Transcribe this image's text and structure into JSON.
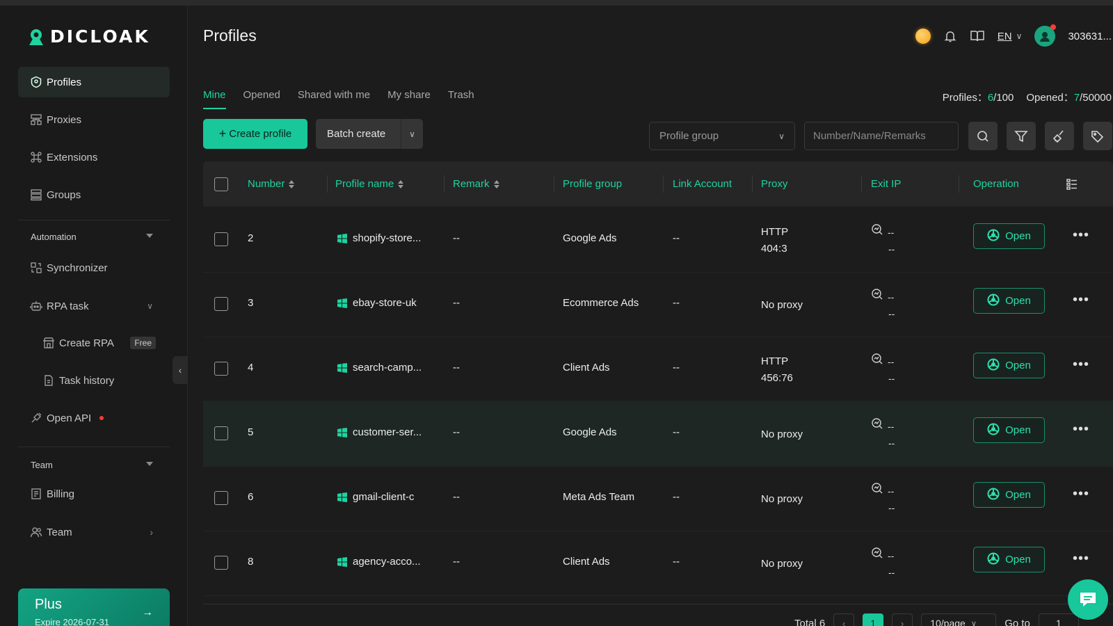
{
  "brand": {
    "name": "DICLOAK"
  },
  "sidebar": {
    "items": [
      {
        "label": "Profiles",
        "icon": "profiles-icon"
      },
      {
        "label": "Proxies",
        "icon": "proxies-icon"
      },
      {
        "label": "Extensions",
        "icon": "extensions-icon"
      },
      {
        "label": "Groups",
        "icon": "groups-icon"
      }
    ],
    "automation": {
      "label": "Automation",
      "items": [
        {
          "label": "Synchronizer"
        },
        {
          "label": "RPA task"
        },
        {
          "label": "Create RPA",
          "badge": "Free"
        },
        {
          "label": "Task history"
        },
        {
          "label": "Open API"
        }
      ]
    },
    "team": {
      "label": "Team",
      "items": [
        {
          "label": "Billing"
        },
        {
          "label": "Team"
        }
      ]
    },
    "plan": {
      "title": "Plus",
      "expire": "Expire 2026-07-31"
    }
  },
  "header": {
    "title": "Profiles",
    "lang": "EN",
    "user": "303631..."
  },
  "tabs": [
    "Mine",
    "Opened",
    "Shared with me",
    "My share",
    "Trash"
  ],
  "counts": {
    "profiles_label": "Profiles：",
    "profiles_used": "6",
    "profiles_total": "/100",
    "opened_label": "Opened：",
    "opened_used": "7",
    "opened_total": "/50000"
  },
  "toolbar": {
    "create_label": "Create profile",
    "batch_label": "Batch create",
    "group_placeholder": "Profile group",
    "search_placeholder": "Number/Name/Remarks"
  },
  "table": {
    "columns": [
      "Number",
      "Profile name",
      "Remark",
      "Profile group",
      "Link Account",
      "Proxy",
      "Exit IP",
      "Operation"
    ],
    "open_label": "Open",
    "rows": [
      {
        "number": "2",
        "name": "shopify-store...",
        "remark": "--",
        "group": "Google Ads",
        "link": "--",
        "proxy1": "HTTP",
        "proxy2": "404:3",
        "exit1": "--",
        "exit2": "--"
      },
      {
        "number": "3",
        "name": "ebay-store-uk",
        "remark": "--",
        "group": "Ecommerce Ads",
        "link": "--",
        "proxy1": "No proxy",
        "proxy2": "",
        "exit1": "--",
        "exit2": "--"
      },
      {
        "number": "4",
        "name": "search-camp...",
        "remark": "--",
        "group": "Client Ads",
        "link": "--",
        "proxy1": "HTTP",
        "proxy2": "456:76",
        "exit1": "--",
        "exit2": "--"
      },
      {
        "number": "5",
        "name": "customer-ser...",
        "remark": "--",
        "group": "Google Ads",
        "link": "--",
        "proxy1": "No proxy",
        "proxy2": "",
        "exit1": "--",
        "exit2": "--"
      },
      {
        "number": "6",
        "name": "gmail-client-c",
        "remark": "--",
        "group": "Meta Ads Team",
        "link": "--",
        "proxy1": "No proxy",
        "proxy2": "",
        "exit1": "--",
        "exit2": "--"
      },
      {
        "number": "8",
        "name": "agency-acco...",
        "remark": "--",
        "group": "Client Ads",
        "link": "--",
        "proxy1": "No proxy",
        "proxy2": "",
        "exit1": "--",
        "exit2": "--"
      }
    ]
  },
  "pagination": {
    "total": "Total 6",
    "current": "1",
    "per_page": "10/page",
    "goto_label": "Go to",
    "goto_value": "1"
  },
  "colors": {
    "accent": "#19c89a",
    "background": "#1c1c1c",
    "sidebar": "#1a1a1a"
  }
}
